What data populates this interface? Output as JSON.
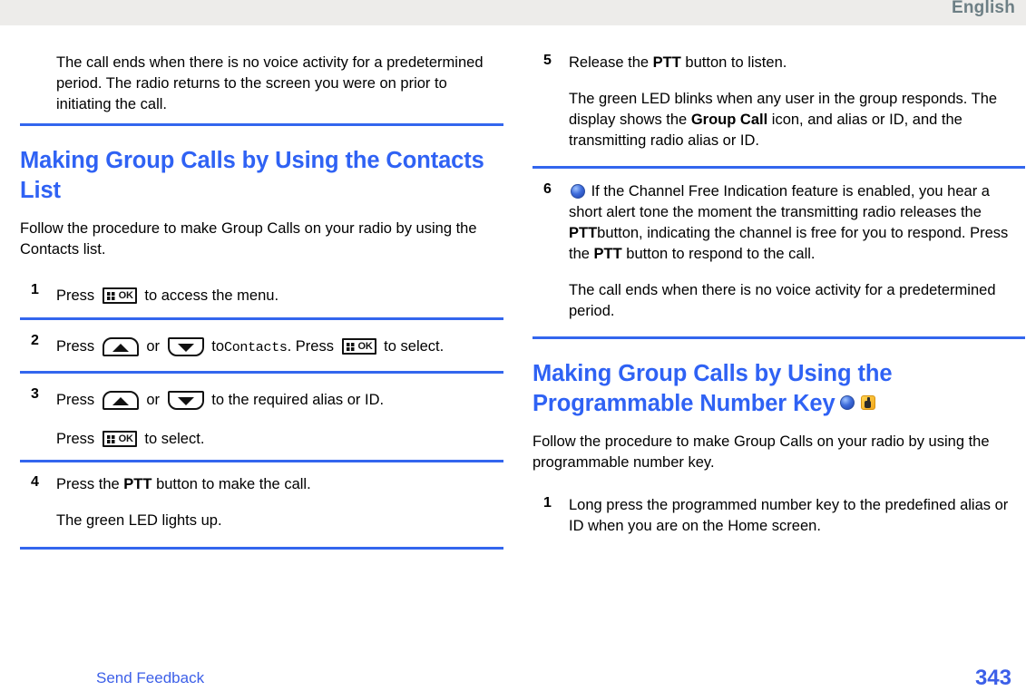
{
  "header": {
    "language_label": "English"
  },
  "left_column": {
    "top_note": "The call ends when there is no voice activity for a predetermined period. The radio returns to the screen you were on prior to initiating the call.",
    "section_title": "Making Group Calls by Using the Contacts List",
    "intro": "Follow the procedure to make Group Calls on your radio by using the Contacts list.",
    "steps": [
      {
        "number": "1",
        "line1_a": "Press",
        "line1_icon": "menu-ok-key-icon",
        "line1_b": "to access the menu."
      },
      {
        "number": "2",
        "a": "Press",
        "icon_up": "up-arrow-key-icon",
        "b": "or",
        "icon_down": "down-arrow-key-icon",
        "c": "to",
        "mono": "Contacts",
        "d": ". Press",
        "icon_ok": "menu-ok-key-icon",
        "e": "to select."
      },
      {
        "number": "3",
        "a": "Press",
        "icon_up": "up-arrow-key-icon",
        "b": "or",
        "icon_down": "down-arrow-key-icon",
        "c": "to the required alias or ID.",
        "line2_a": "Press",
        "line2_icon": "menu-ok-key-icon",
        "line2_b": "to select."
      },
      {
        "number": "4",
        "a": "Press the",
        "bold": "PTT",
        "b": "button to make the call.",
        "line2": "The green LED lights up."
      }
    ]
  },
  "right_column": {
    "steps": [
      {
        "number": "5",
        "a": "Release the",
        "bold": "PTT",
        "b": "button to listen.",
        "line2_a": "The green LED blinks when any user in the group responds. The display shows the",
        "line2_bold": "Group Call",
        "line2_b": "icon, and alias or ID, and the transmitting radio alias or ID."
      },
      {
        "number": "6",
        "icon": "blue-sphere-icon",
        "a": "If the Channel Free Indication feature is enabled, you hear a short alert tone the moment the transmitting radio releases the",
        "bold1": "PTT",
        "b": "button, indicating the channel is free for you to respond. Press the",
        "bold2": "PTT",
        "c": "button to respond to the call.",
        "line2": "The call ends when there is no voice activity for a predetermined period."
      }
    ],
    "section_title": "Making Group Calls by Using the Programmable Number Key",
    "section_icons": [
      "blue-sphere-icon",
      "yellow-radio-icon"
    ],
    "intro": "Follow the procedure to make Group Calls on your radio by using the programmable number key.",
    "steps2": [
      {
        "number": "1",
        "text": "Long press the programmed number key to the predefined alias or ID when you are on the Home screen."
      }
    ]
  },
  "footer": {
    "send_feedback": "Send Feedback",
    "page_number": "343"
  },
  "colors": {
    "heading_blue": "#2F62F4",
    "rule_blue": "#3366EE",
    "link_blue": "#3C5FE8",
    "header_band": "#EDECEA",
    "header_text": "#6D7F85"
  }
}
